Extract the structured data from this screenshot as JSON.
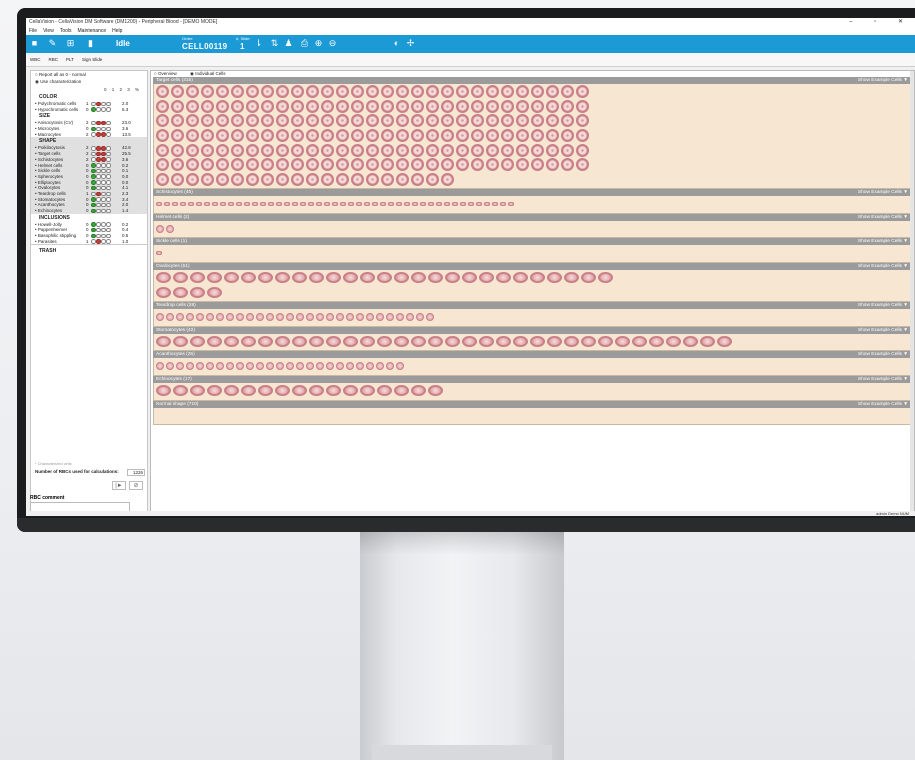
{
  "window": {
    "title": "CellaVision - CellaVision DM Software (DM1200) - Peripheral Blood - [DEMO MODE]",
    "controls": "–  ▫  ✕"
  },
  "menu": [
    "File",
    "View",
    "Tools",
    "Maintenance",
    "Help"
  ],
  "toolbar": {
    "status": "Idle",
    "order_label": "Order:",
    "order": "CELL00119",
    "slide_label": "#, Slide:",
    "slide": "1"
  },
  "subbar": {
    "tabs": [
      "WBC",
      "RBC",
      "PLT",
      "Sign Slide"
    ]
  },
  "left": {
    "options": [
      "Report all as 0 - normal",
      "Use characterization"
    ],
    "grades_header": "0 1 2 3 %",
    "groups": [
      {
        "title": "COLOR",
        "shaded": false,
        "items": [
          {
            "name": "Polychromatic cells",
            "grade": "1",
            "level": 1,
            "pct": "2.0"
          },
          {
            "name": "Hypochromatic cells",
            "grade": "0",
            "level": 0,
            "pct": "5.3"
          }
        ]
      },
      {
        "title": "SIZE",
        "shaded": false,
        "items": [
          {
            "name": "Anisocytosis (CV)",
            "grade": "2",
            "level": 2,
            "pct": "23.0"
          },
          {
            "name": "Microcytes",
            "grade": "0",
            "level": 0,
            "pct": "3.6"
          },
          {
            "name": "Macrocytes",
            "grade": "2",
            "level": 2,
            "pct": "13.5"
          }
        ]
      },
      {
        "title": "SHAPE",
        "shaded": true,
        "items": [
          {
            "name": "Poikilocytosis",
            "grade": "2",
            "level": 2,
            "pct": "42.6"
          },
          {
            "name": "Target cells",
            "grade": "2",
            "level": 2,
            "pct": "25.5"
          },
          {
            "name": "Schistocytes",
            "grade": "2",
            "level": 2,
            "pct": "3.6"
          },
          {
            "name": "Helmet cells",
            "grade": "0",
            "level": 0,
            "pct": "0.2"
          },
          {
            "name": "Sickle cells",
            "grade": "0",
            "level": 0,
            "pct": "0.1"
          },
          {
            "name": "Spherocytes",
            "grade": "0",
            "level": 0,
            "pct": "0.0"
          },
          {
            "name": "Elliptocytes",
            "grade": "0",
            "level": 0,
            "pct": "0.0"
          },
          {
            "name": "Ovalocytes",
            "grade": "0",
            "level": 0,
            "pct": "4.1"
          },
          {
            "name": "Teardrop cells",
            "grade": "1",
            "level": 1,
            "pct": "2.3"
          },
          {
            "name": "Stomatocytes",
            "grade": "0",
            "level": 0,
            "pct": "3.4"
          },
          {
            "name": "Acanthocytes",
            "grade": "0",
            "level": 0,
            "pct": "2.0"
          },
          {
            "name": "Echinocytes",
            "grade": "0",
            "level": 0,
            "pct": "1.4"
          }
        ]
      },
      {
        "title": "INCLUSIONS",
        "shaded": false,
        "items": [
          {
            "name": "Howell-Jolly",
            "grade": "0",
            "level": 0,
            "pct": "0.2"
          },
          {
            "name": "Pappenheimer",
            "grade": "0",
            "level": 0,
            "pct": "0.4"
          },
          {
            "name": "Basophilic stippling",
            "grade": "0",
            "level": 0,
            "pct": "0.5"
          },
          {
            "name": "Parasites",
            "grade": "1",
            "level": 1,
            "pct": "1.0"
          }
        ]
      }
    ],
    "trash": "TRASH",
    "note": "* Characterized cells",
    "nrbc_label": "Number of RBCs used for calculations:",
    "nrbc_value": "1226",
    "rbc_comment": "RBC comment"
  },
  "main": {
    "tabs": [
      "Overview",
      "Individual Cells"
    ],
    "show_label": "Show Example Cells ▼",
    "sections": [
      {
        "title": "Target cells (315)",
        "kind": "t",
        "rows": [
          29,
          29,
          29,
          29,
          29,
          29,
          20
        ]
      },
      {
        "title": "Schistocytes (45)",
        "kind": "frag",
        "rows": [
          45
        ]
      },
      {
        "title": "Helmet cells (2)",
        "kind": "small",
        "rows": [
          2
        ]
      },
      {
        "title": "Sickle cells (1)",
        "kind": "frag",
        "rows": [
          1
        ]
      },
      {
        "title": "Ovalocytes (51)",
        "kind": "oval",
        "rows": [
          27,
          4
        ]
      },
      {
        "title": "Teardrop cells (28)",
        "kind": "small",
        "rows": [
          28
        ]
      },
      {
        "title": "Stomatocytes (42)",
        "kind": "oval",
        "rows": [
          34
        ]
      },
      {
        "title": "Acanthocytes (25)",
        "kind": "small",
        "rows": [
          25
        ]
      },
      {
        "title": "Echinocytes (17)",
        "kind": "oval",
        "rows": [
          17
        ]
      },
      {
        "title": "Normal shape (710)",
        "kind": "t",
        "rows": [
          0
        ]
      }
    ]
  },
  "statusbar": "admin  Demo     NUM"
}
